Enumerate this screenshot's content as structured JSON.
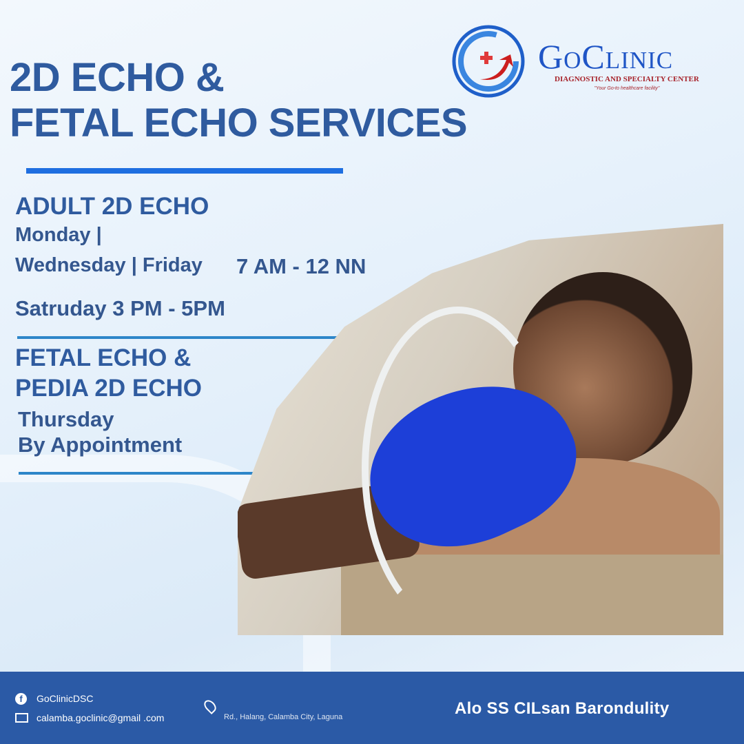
{
  "title": {
    "line1": "2D ECHO &",
    "line2": "FETAL ECHO SERVICES"
  },
  "logo": {
    "name": "GoClinic",
    "subtitle": "DIAGNOSTIC AND SPECIALTY CENTER",
    "tagline": "\"Your Go-to healthcare facility\""
  },
  "adult": {
    "heading": "ADULT 2D ECHO",
    "days1": "Monday |",
    "days2": "Wednesday | Friday",
    "time": "7 AM - 12 NN",
    "saturday": "Satruday 3 PM - 5PM"
  },
  "fetal": {
    "heading1": "FETAL ECHO &",
    "heading2": "PEDIA 2D ECHO",
    "day": "Thursday",
    "note": "By Appointment"
  },
  "footer": {
    "facebook": "GoClinicDSC",
    "email": "calamba.goclinic@gmail .com",
    "address": "Rd., Halang, Calamba City, Laguna",
    "slogan": "Alo SS CILsan Barondulity"
  },
  "colors": {
    "title": "#2f5b9f",
    "footer": "#2b5aa6",
    "accent": "#1e6ee0",
    "logo_red": "#d62a2a"
  }
}
